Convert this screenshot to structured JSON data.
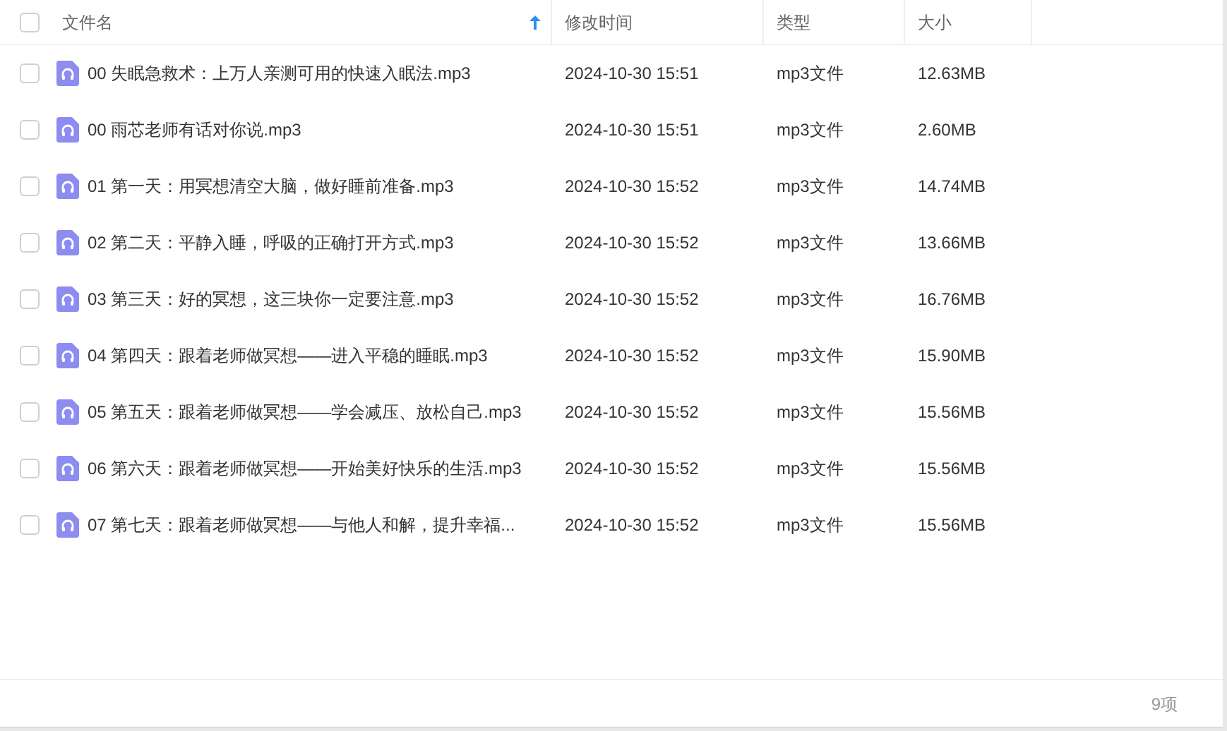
{
  "table": {
    "select_all": {
      "checked": false
    },
    "columns": [
      {
        "label": "文件名",
        "sorted": true
      },
      {
        "label": "修改时间",
        "sorted": false
      },
      {
        "label": "类型",
        "sorted": false
      },
      {
        "label": "大小",
        "sorted": false
      }
    ],
    "rows": [
      {
        "name": "00 失眠急救术：上万人亲测可用的快速入眠法.mp3",
        "modified": "2024-10-30 15:51",
        "type": "mp3文件",
        "size": "12.63MB",
        "checked": false
      },
      {
        "name": "00 雨芯老师有话对你说.mp3",
        "modified": "2024-10-30 15:51",
        "type": "mp3文件",
        "size": "2.60MB",
        "checked": false
      },
      {
        "name": "01 第一天：用冥想清空大脑，做好睡前准备.mp3",
        "modified": "2024-10-30 15:52",
        "type": "mp3文件",
        "size": "14.74MB",
        "checked": false
      },
      {
        "name": "02 第二天：平静入睡，呼吸的正确打开方式.mp3",
        "modified": "2024-10-30 15:52",
        "type": "mp3文件",
        "size": "13.66MB",
        "checked": false
      },
      {
        "name": "03 第三天：好的冥想，这三块你一定要注意.mp3",
        "modified": "2024-10-30 15:52",
        "type": "mp3文件",
        "size": "16.76MB",
        "checked": false
      },
      {
        "name": "04 第四天：跟着老师做冥想——进入平稳的睡眠.mp3",
        "modified": "2024-10-30 15:52",
        "type": "mp3文件",
        "size": "15.90MB",
        "checked": false
      },
      {
        "name": "05 第五天：跟着老师做冥想——学会减压、放松自己.mp3",
        "modified": "2024-10-30 15:52",
        "type": "mp3文件",
        "size": "15.56MB",
        "checked": false
      },
      {
        "name": "06 第六天：跟着老师做冥想——开始美好快乐的生活.mp3",
        "modified": "2024-10-30 15:52",
        "type": "mp3文件",
        "size": "15.56MB",
        "checked": false
      },
      {
        "name": "07 第七天：跟着老师做冥想——与他人和解，提升幸福...",
        "modified": "2024-10-30 15:52",
        "type": "mp3文件",
        "size": "15.56MB",
        "checked": false
      }
    ]
  },
  "status_bar": {
    "count": "9项"
  }
}
